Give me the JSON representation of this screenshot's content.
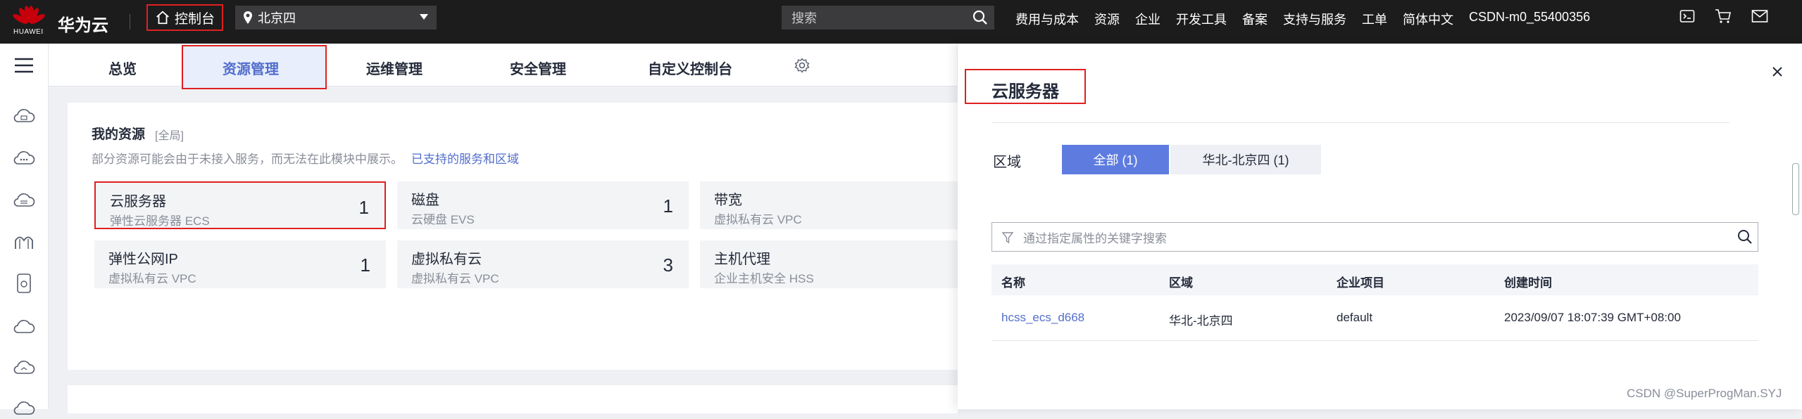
{
  "topbar": {
    "logo_text": "HUAWEI",
    "brand": "华为云",
    "console_label": "控制台",
    "region": "北京四",
    "search_placeholder": "搜索",
    "nav": [
      "费用与成本",
      "资源",
      "企业",
      "开发工具",
      "备案",
      "支持与服务",
      "工单",
      "简体中文",
      "CSDN-m0_55400356"
    ]
  },
  "tabs": [
    "总览",
    "资源管理",
    "运维管理",
    "安全管理",
    "自定义控制台"
  ],
  "active_tab": "资源管理",
  "resources": {
    "title": "我的资源",
    "scope": "[全局]",
    "note": "部分资源可能会由于未接入服务，而无法在此模块中展示。",
    "note_link": "已支持的服务和区域",
    "tiles": [
      {
        "name": "云服务器",
        "sub": "弹性云服务器 ECS",
        "count": "1"
      },
      {
        "name": "磁盘",
        "sub": "云硬盘 EVS",
        "count": "1"
      },
      {
        "name": "带宽",
        "sub": "虚拟私有云 VPC",
        "count": ""
      },
      {
        "name": "弹性公网IP",
        "sub": "虚拟私有云 VPC",
        "count": "1"
      },
      {
        "name": "虚拟私有云",
        "sub": "虚拟私有云 VPC",
        "count": "3"
      },
      {
        "name": "主机代理",
        "sub": "企业主机安全 HSS",
        "count": ""
      }
    ]
  },
  "panel": {
    "title": "云服务器",
    "region_label": "区域",
    "segments": [
      "全部 (1)",
      "华北-北京四 (1)"
    ],
    "filter_placeholder": "通过指定属性的关键字搜索",
    "columns": [
      "名称",
      "区域",
      "企业项目",
      "创建时间"
    ],
    "rows": [
      {
        "name": "hcss_ecs_d668",
        "region": "华北-北京四",
        "project": "default",
        "created": "2023/09/07 18:07:39 GMT+08:00"
      }
    ]
  },
  "watermark": "CSDN @SuperProgMan.SYJ",
  "colors": {
    "accent": "#526ecc",
    "highlight": "#e02020",
    "topbar": "#1c1c1d"
  }
}
